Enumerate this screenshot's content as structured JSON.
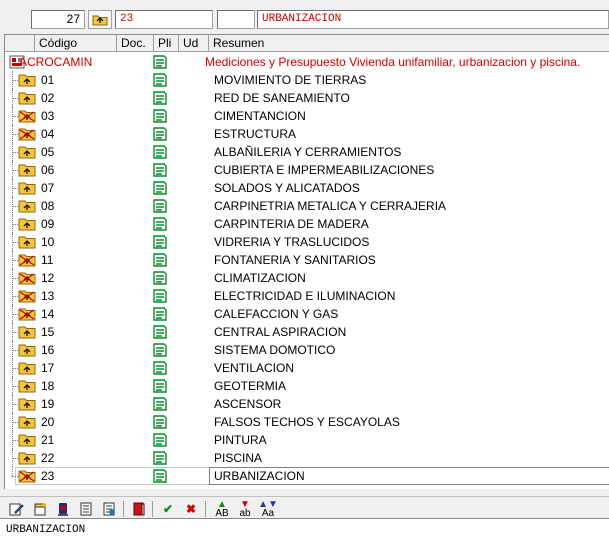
{
  "toolbar": {
    "code_value": "27",
    "folder_icon": "folder-up-icon",
    "number_value": "23",
    "blank_value": "",
    "description_value": "URBANIZACION"
  },
  "columns": {
    "codigo": "Código",
    "doc": "Doc.",
    "pli": "Pli",
    "ud": "Ud",
    "resumen": "Resumen"
  },
  "root": {
    "code": "ACROCAMIN",
    "summary": "Mediciones y Presupuesto Vivienda unifamiliar, urbanizacion y piscina."
  },
  "chapters": [
    {
      "code": "01",
      "summary": "MOVIMIENTO DE TIERRAS",
      "icon": "folder-icon"
    },
    {
      "code": "02",
      "summary": "RED DE SANEAMIENTO",
      "icon": "folder-icon"
    },
    {
      "code": "03",
      "summary": "CIMENTANCION",
      "icon": "folder-crossed-icon"
    },
    {
      "code": "04",
      "summary": "ESTRUCTURA",
      "icon": "folder-crossed-icon"
    },
    {
      "code": "05",
      "summary": "ALBAÑILERIA Y CERRAMIENTOS",
      "icon": "folder-icon"
    },
    {
      "code": "06",
      "summary": "CUBIERTA E IMPERMEABILIZACIONES",
      "icon": "folder-icon"
    },
    {
      "code": "07",
      "summary": "SOLADOS Y ALICATADOS",
      "icon": "folder-icon"
    },
    {
      "code": "08",
      "summary": "CARPINETRIA METALICA Y CERRAJERIA",
      "icon": "folder-icon"
    },
    {
      "code": "09",
      "summary": "CARPINTERIA DE MADERA",
      "icon": "folder-icon"
    },
    {
      "code": "10",
      "summary": "VIDRERIA Y TRASLUCIDOS",
      "icon": "folder-icon"
    },
    {
      "code": "11",
      "summary": "FONTANERIA Y SANITARIOS",
      "icon": "folder-crossed-icon"
    },
    {
      "code": "12",
      "summary": "CLIMATIZACION",
      "icon": "folder-crossed-icon"
    },
    {
      "code": "13",
      "summary": "ELECTRICIDAD E ILUMINACION",
      "icon": "folder-crossed-icon"
    },
    {
      "code": "14",
      "summary": "CALEFACCION Y GAS",
      "icon": "folder-crossed-icon"
    },
    {
      "code": "15",
      "summary": "CENTRAL ASPIRACION",
      "icon": "folder-icon"
    },
    {
      "code": "16",
      "summary": "SISTEMA DOMOTICO",
      "icon": "folder-icon"
    },
    {
      "code": "17",
      "summary": "VENTILACION",
      "icon": "folder-icon"
    },
    {
      "code": "18",
      "summary": "GEOTERMIA",
      "icon": "folder-icon"
    },
    {
      "code": "19",
      "summary": "ASCENSOR",
      "icon": "folder-icon"
    },
    {
      "code": "20",
      "summary": "FALSOS TECHOS Y ESCAYOLAS",
      "icon": "folder-icon"
    },
    {
      "code": "21",
      "summary": "PINTURA",
      "icon": "folder-icon"
    },
    {
      "code": "22",
      "summary": "PISCINA",
      "icon": "folder-icon"
    },
    {
      "code": "23",
      "summary": "URBANIZACION",
      "icon": "folder-crossed-icon"
    }
  ],
  "bottom_toolbar": {
    "buttons": [
      "edit-icon",
      "new-document-icon",
      "stamp-icon",
      "list-icon",
      "list-alt-icon",
      "book-icon",
      "check-icon",
      "cross-icon",
      "ab-upper-icon",
      "ab-lower-icon",
      "ab-mixed-icon"
    ],
    "labels": {
      "ab_upper": "AB",
      "ab_lower": "ab",
      "ab_mixed": "Aa"
    }
  },
  "memo": {
    "text": "URBANIZACION"
  },
  "colors": {
    "accent_red": "#d00000",
    "folder_yellow": "#f5c542",
    "pli_green": "#0a8a2a"
  }
}
